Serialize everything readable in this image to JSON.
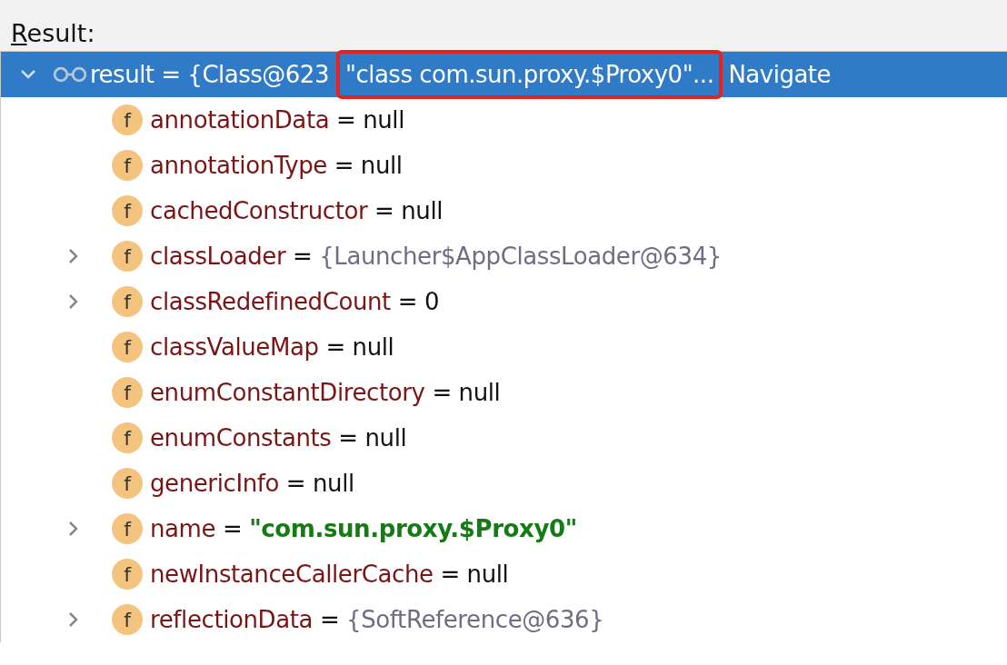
{
  "header": {
    "label": "Result:"
  },
  "root": {
    "selected": true,
    "expanded": true,
    "label": "result = {Class@623",
    "value": "\"class com.sun.proxy.$Proxy0\"...",
    "annotated": true,
    "link": "Navigate"
  },
  "fields": [
    {
      "icon": "f",
      "name": "annotationData",
      "operator": "=",
      "value": "null",
      "kind": "null",
      "expandable": false
    },
    {
      "icon": "f",
      "name": "annotationType",
      "operator": "=",
      "value": "null",
      "kind": "null",
      "expandable": false
    },
    {
      "icon": "f",
      "name": "cachedConstructor",
      "operator": "=",
      "value": "null",
      "kind": "null",
      "expandable": false
    },
    {
      "icon": "f",
      "name": "classLoader",
      "operator": "=",
      "value": "{Launcher$AppClassLoader@634}",
      "kind": "object",
      "expandable": true
    },
    {
      "icon": "f",
      "name": "classRedefinedCount",
      "operator": "=",
      "value": "0",
      "kind": "number",
      "expandable": true
    },
    {
      "icon": "f",
      "name": "classValueMap",
      "operator": "=",
      "value": "null",
      "kind": "null",
      "expandable": false
    },
    {
      "icon": "f",
      "name": "enumConstantDirectory",
      "operator": "=",
      "value": "null",
      "kind": "null",
      "expandable": false
    },
    {
      "icon": "f",
      "name": "enumConstants",
      "operator": "=",
      "value": "null",
      "kind": "null",
      "expandable": false
    },
    {
      "icon": "f",
      "name": "genericInfo",
      "operator": "=",
      "value": "null",
      "kind": "null",
      "expandable": false
    },
    {
      "icon": "f",
      "name": "name",
      "operator": "=",
      "value": "\"com.sun.proxy.$Proxy0\"",
      "kind": "string",
      "expandable": true
    },
    {
      "icon": "f",
      "name": "newInstanceCallerCache",
      "operator": "=",
      "value": "null",
      "kind": "null",
      "expandable": false
    },
    {
      "icon": "f",
      "name": "reflectionData",
      "operator": "=",
      "value": "{SoftReference@636}",
      "kind": "object",
      "expandable": true
    }
  ]
}
